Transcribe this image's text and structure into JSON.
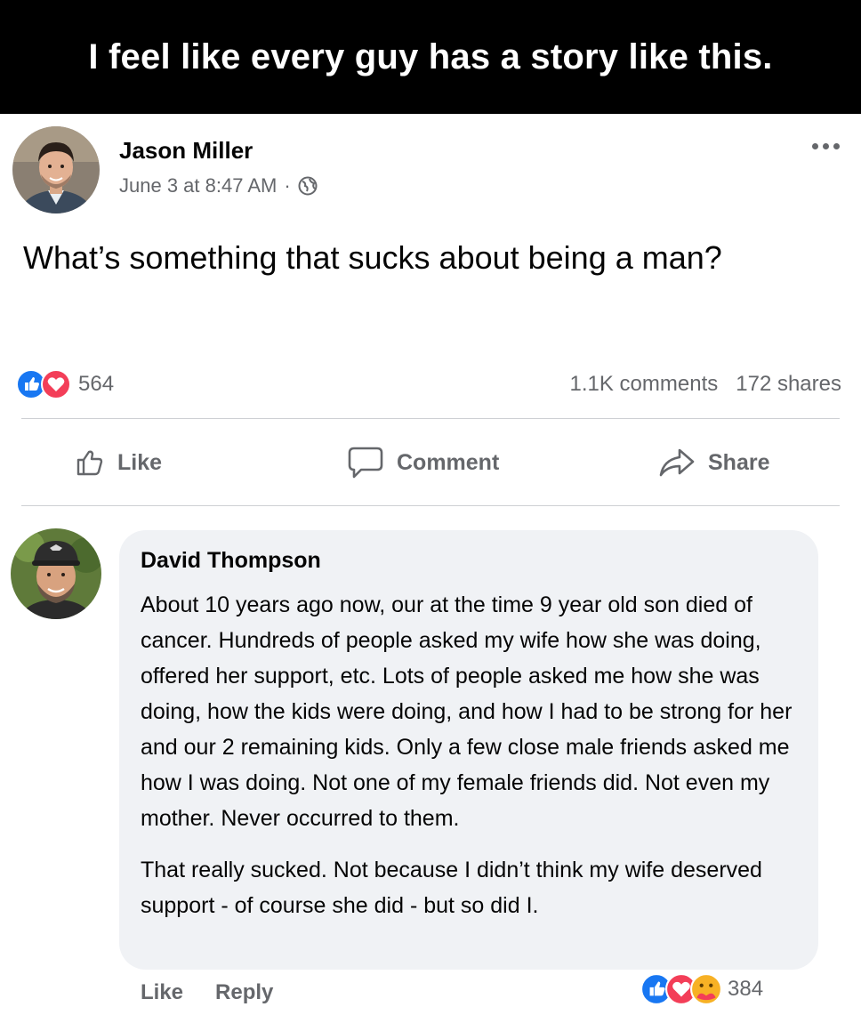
{
  "caption": "I feel like every guy has a story like this.",
  "post": {
    "author": "Jason Miller",
    "timestamp": "June 3 at 8:47 AM",
    "separator": "·",
    "audience_icon": "globe-icon",
    "text": "What’s something that sucks about being a man?",
    "reactions": {
      "icons": [
        "like",
        "love"
      ],
      "count": "564"
    },
    "comments": "1.1K comments",
    "shares": "172 shares",
    "actions": {
      "like": "Like",
      "comment": "Comment",
      "share": "Share"
    }
  },
  "comment": {
    "author": "David Thompson",
    "paragraphs": [
      "About 10 years ago now, our at the time 9 year old son died of cancer. Hundreds of people asked my wife how she was doing, offered her support, etc. Lots of people asked me how she was doing, how the kids were doing, and how I had to be strong for her and our 2 remaining kids. Only a few close male friends asked me how I was doing. Not one of my female friends did. Not even my mother. Never occurred to them.",
      "That really sucked. Not because I didn’t think my wife deserved support - of course she did - but so did I."
    ],
    "actions": {
      "like": "Like",
      "reply": "Reply"
    },
    "reactions": {
      "icons": [
        "like",
        "love",
        "care"
      ],
      "count": "384"
    }
  },
  "colors": {
    "like_blue": "#1877f2",
    "love_red": "#f33e58",
    "care_yellow": "#f7b125",
    "secondary_text": "#65676b",
    "bubble_bg": "#f0f2f5"
  }
}
